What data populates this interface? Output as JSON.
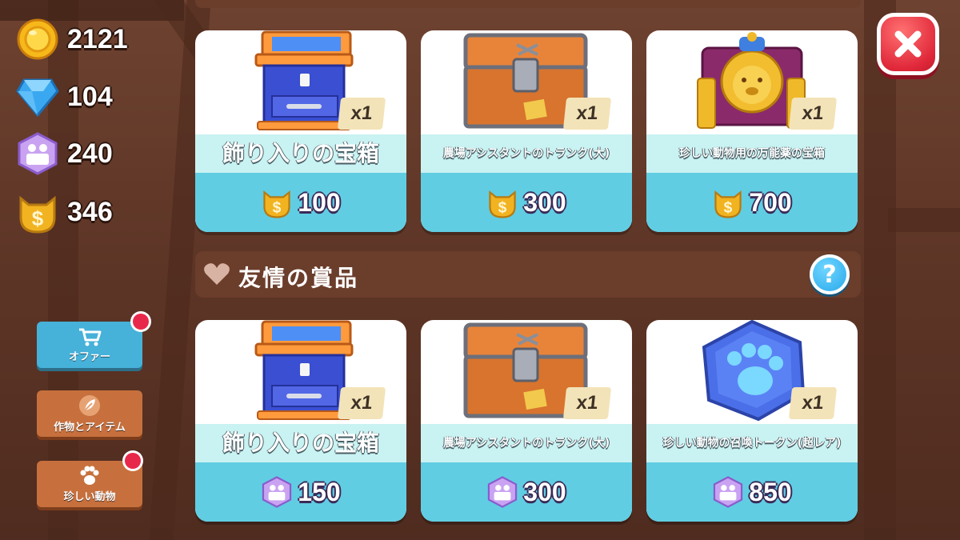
{
  "currencies": [
    {
      "icon": "gold-coin-icon",
      "value": "2121"
    },
    {
      "icon": "diamond-icon",
      "value": "104"
    },
    {
      "icon": "friendship-token-icon",
      "value": "240"
    },
    {
      "icon": "cat-coin-icon",
      "value": "346"
    }
  ],
  "shop_cards": [
    {
      "name": "飾り入りの宝箱",
      "qty": "x1",
      "price": "100",
      "price_icon": "cat-coin-icon",
      "art": "decorated-chest"
    },
    {
      "name": "農場アシスタントのトランク(大)",
      "qty": "x1",
      "price": "300",
      "price_icon": "cat-coin-icon",
      "art": "farm-trunk"
    },
    {
      "name": "珍しい動物用の万能薬の宝箱",
      "qty": "x1",
      "price": "700",
      "price_icon": "cat-coin-icon",
      "art": "lion-chest"
    }
  ],
  "friendship_section": {
    "title": "友情の賞品",
    "help": "?"
  },
  "friendship_cards": [
    {
      "name": "飾り入りの宝箱",
      "qty": "x1",
      "price": "150",
      "price_icon": "friendship-token-icon",
      "art": "decorated-chest"
    },
    {
      "name": "農場アシスタントのトランク(大)",
      "qty": "x1",
      "price": "300",
      "price_icon": "friendship-token-icon",
      "art": "farm-trunk"
    },
    {
      "name": "珍しい動物の召喚トークン(超レア)",
      "qty": "x1",
      "price": "850",
      "price_icon": "friendship-token-icon",
      "art": "paw-token"
    }
  ],
  "side_nav": [
    {
      "label": "オファー",
      "icon": "cart-icon",
      "notification": true
    },
    {
      "label": "作物とアイテム",
      "icon": "leaf-icon",
      "notification": false
    },
    {
      "label": "珍しい動物",
      "icon": "paw-icon",
      "notification": true
    }
  ],
  "colors": {
    "price_band": "#60cde3",
    "name_band": "#c9f2f2",
    "close": "#e0283a",
    "panel": "#6b3d2b"
  }
}
